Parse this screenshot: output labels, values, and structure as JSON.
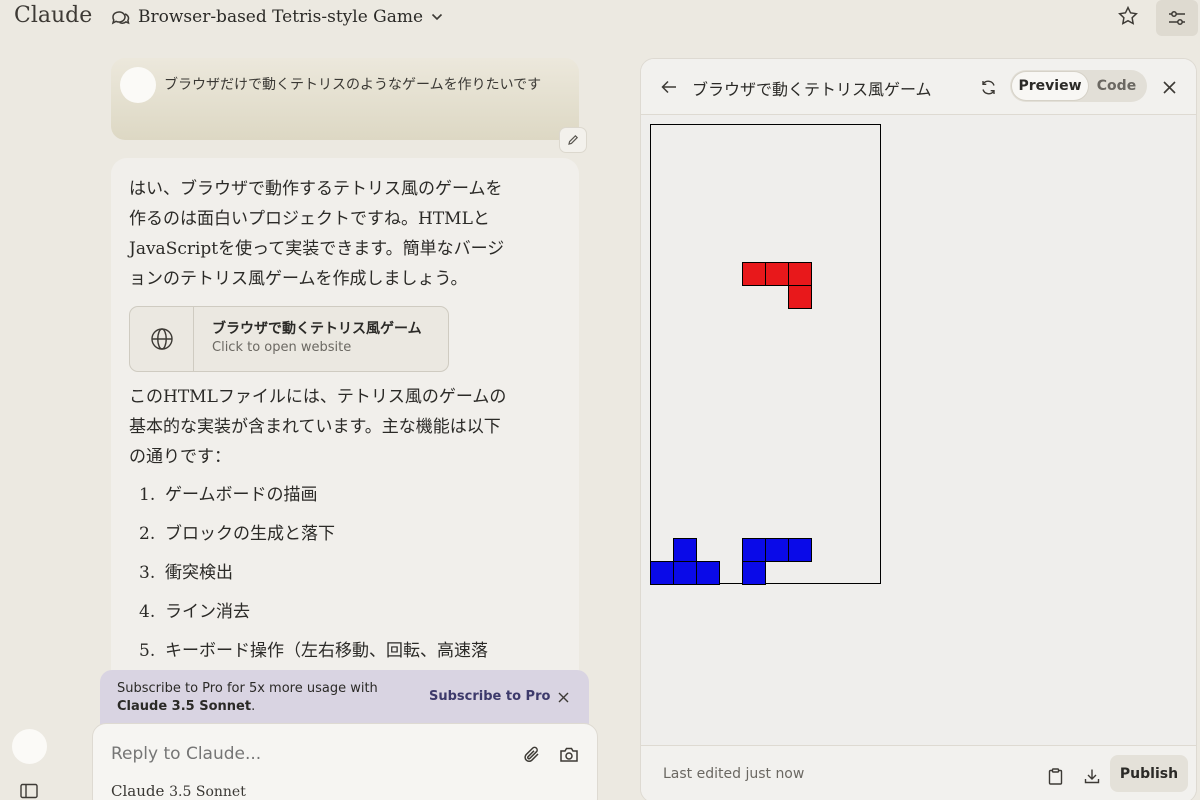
{
  "app": {
    "brand": "Claude"
  },
  "header": {
    "conversation_title": "Browser-based Tetris-style Game"
  },
  "chat": {
    "user_message": "ブラウザだけで動くテトリスのようなゲームを作りたいです",
    "assistant": {
      "intro": "はい、ブラウザで動作するテトリス風のゲームを作るのは面白いプロジェクトですね。HTMLとJavaScriptを使って実装できます。簡単なバージョンのテトリス風ゲームを作成しましょう。",
      "artifact_card": {
        "title": "ブラウザで動くテトリス風ゲーム",
        "subtitle": "Click to open website",
        "icon": "globe-icon"
      },
      "summary": "このHTMLファイルには、テトリス風のゲームの基本的な実装が含まれています。主な機能は以下の通りです：",
      "features": [
        {
          "num": "1.",
          "text": "ゲームボードの描画"
        },
        {
          "num": "2.",
          "text": "ブロックの生成と落下"
        },
        {
          "num": "3.",
          "text": "衝突検出"
        },
        {
          "num": "4.",
          "text": "ライン消去"
        },
        {
          "num": "5.",
          "text": "キーボード操作（左右移動、回転、高速落"
        }
      ]
    }
  },
  "banner": {
    "text_line1": "Subscribe to Pro for 5x more usage with",
    "text_line2": "Claude 3.5 Sonnet",
    "text_line2_suffix": ".",
    "link": "Subscribe to Pro"
  },
  "composer": {
    "placeholder": "Reply to Claude...",
    "model_name": "Claude",
    "model_version": "3.5 Sonnet"
  },
  "panel": {
    "title": "ブラウザで動くテトリス風ゲーム",
    "tabs": {
      "preview": "Preview",
      "code": "Code"
    },
    "active_tab": "Preview",
    "footer_status": "Last edited just now",
    "publish": "Publish"
  },
  "game": {
    "cols": 10,
    "rows": 20,
    "colors": {
      "falling": "#e8181b",
      "landed": "#0a0ae8",
      "border": "#000000"
    },
    "falling_piece": [
      [
        4,
        6
      ],
      [
        5,
        6
      ],
      [
        6,
        6
      ],
      [
        6,
        7
      ]
    ],
    "landed_blocks": [
      [
        1,
        18
      ],
      [
        0,
        19
      ],
      [
        1,
        19
      ],
      [
        2,
        19
      ],
      [
        4,
        18
      ],
      [
        5,
        18
      ],
      [
        6,
        18
      ],
      [
        4,
        19
      ]
    ]
  }
}
